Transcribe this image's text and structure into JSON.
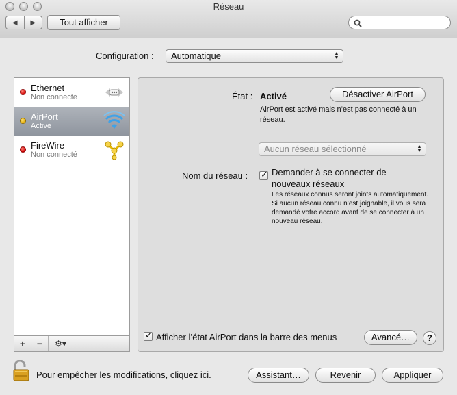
{
  "window": {
    "title": "Réseau"
  },
  "toolbar": {
    "show_all_label": "Tout afficher",
    "back_glyph": "◀",
    "forward_glyph": "▶",
    "search_placeholder": ""
  },
  "configuration": {
    "label": "Configuration :",
    "value": "Automatique"
  },
  "services": [
    {
      "name": "Ethernet",
      "status": "Non connecté",
      "status_color": "#d40000",
      "icon": "ethernet-icon",
      "selected": false
    },
    {
      "name": "AirPort",
      "status": "Activé",
      "status_color": "#e2a800",
      "icon": "airport-wifi-icon",
      "selected": true
    },
    {
      "name": "FireWire",
      "status": "Non connecté",
      "status_color": "#d40000",
      "icon": "firewire-icon",
      "selected": false
    }
  ],
  "sidebar_bar": {
    "add": "+",
    "remove": "−",
    "gear": "⚙▾"
  },
  "detail": {
    "state_label": "État :",
    "state_value": "Activé",
    "deactivate_button": "Désactiver AirPort",
    "state_description": "AirPort est activé mais n’est pas connecté à un réseau.",
    "network_popup_value": "Aucun réseau sélectionné",
    "network_name_label": "Nom du réseau :",
    "ask_checkbox_checked": true,
    "ask_label": "Demander à se connecter de nouveaux réseaux",
    "ask_description": "Les réseaux connus seront joints automatiquement. Si aucun réseau connu n’est joignable, il vous sera demandé votre accord avant de se connecter à un nouveau réseau.",
    "menubar_checkbox_checked": true,
    "menubar_label": "Afficher l’état AirPort dans la barre des menus",
    "advanced_button": "Avancé…",
    "help_label": "?"
  },
  "footer": {
    "lock_text": "Pour empêcher les modifications, cliquez ici.",
    "assistant_button": "Assistant…",
    "revert_button": "Revenir",
    "apply_button": "Appliquer"
  }
}
